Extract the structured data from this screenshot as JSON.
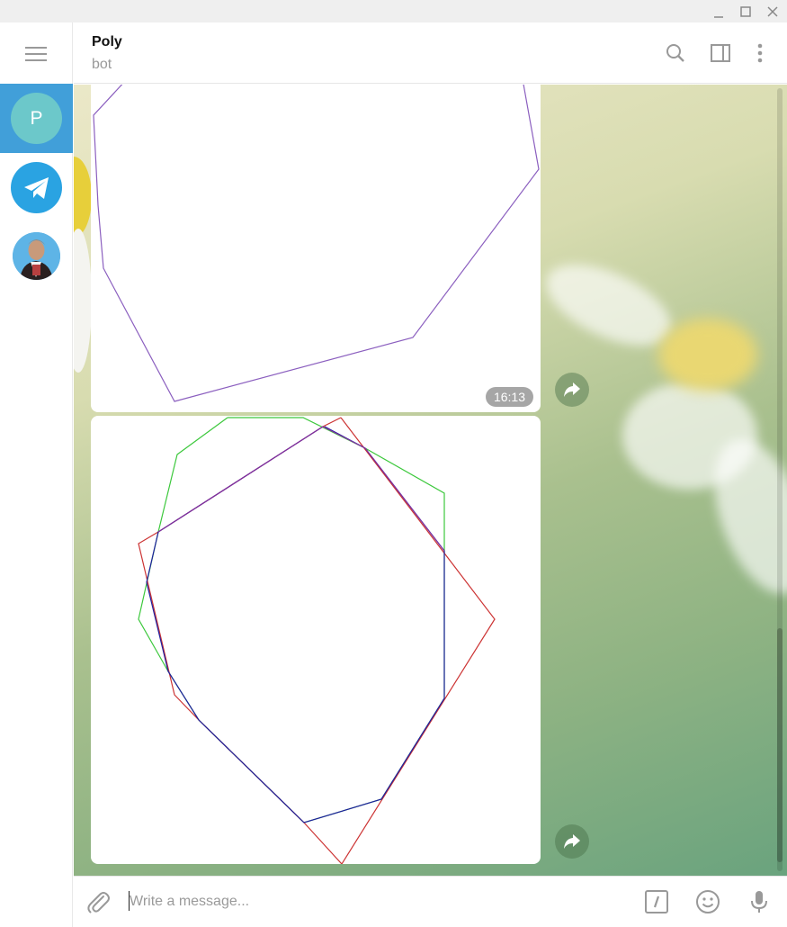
{
  "window": {
    "controls": [
      "minimize-icon",
      "maximize-icon",
      "close-icon"
    ]
  },
  "sidebar": {
    "menu_icon": "hamburger-icon",
    "chats": [
      {
        "avatar_letter": "P",
        "active": true,
        "color": "#6cc8ca"
      },
      {
        "avatar_icon": "telegram-logo-icon",
        "active": false,
        "color": "#2aa3e2"
      },
      {
        "avatar_icon": "user-photo-avatar",
        "active": false
      }
    ]
  },
  "header": {
    "title": "Poly",
    "subtitle": "bot",
    "icons": [
      "search-icon",
      "sidebar-toggle-icon",
      "more-vertical-icon"
    ]
  },
  "messages": [
    {
      "type": "image",
      "time": "16:13",
      "polygons": [
        {
          "color": "#8b5fbf"
        }
      ]
    },
    {
      "type": "image",
      "polygons": [
        {
          "color": "#3cc83c"
        },
        {
          "color": "#cc3333"
        },
        {
          "color": "#2020a0"
        },
        {
          "color": "#8b2fa0"
        }
      ]
    }
  ],
  "composer": {
    "placeholder": "Write a message...",
    "icons": [
      "attach-icon",
      "bot-command-icon",
      "emoji-icon",
      "microphone-icon"
    ]
  },
  "colors": {
    "accent": "#419fd9",
    "icon_gray": "#999999"
  }
}
